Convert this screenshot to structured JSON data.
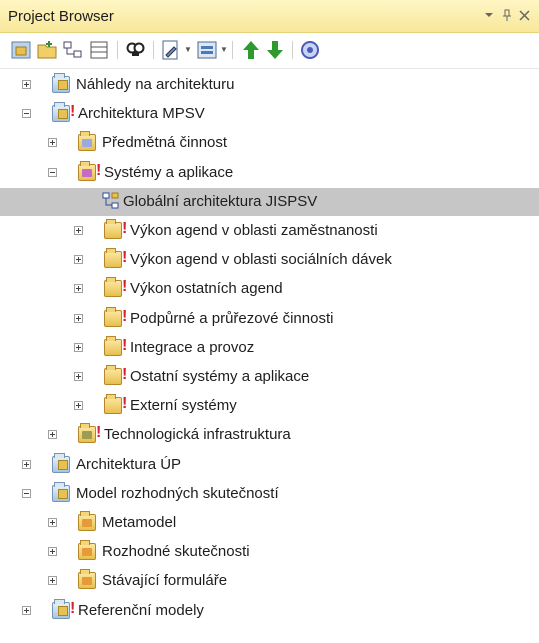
{
  "panel": {
    "title": "Project Browser",
    "controls": {
      "dropdown_icon": "chevron-down-icon",
      "pin_icon": "pin-icon",
      "close_icon": "close-icon"
    }
  },
  "toolbar": {
    "buttons": [
      "new-model-icon",
      "new-package-icon",
      "new-diagram-icon",
      "new-element-icon",
      "find-icon",
      "documentation-icon",
      "view-icon",
      "move-up-icon",
      "move-down-icon",
      "properties-icon"
    ]
  },
  "tree": [
    {
      "label": "Náhledy na architekturu",
      "icon": "model-package-icon",
      "expander": "collapsed",
      "flag": false,
      "selected": false
    },
    {
      "label": "Architektura MPSV",
      "icon": "model-package-icon",
      "expander": "expanded",
      "flag": true,
      "selected": false
    },
    {
      "label": "Předmětná činnost",
      "icon": "view-package-blue-icon",
      "expander": "collapsed",
      "flag": false,
      "selected": false
    },
    {
      "label": "Systémy a aplikace",
      "icon": "view-package-pink-icon",
      "expander": "expanded",
      "flag": true,
      "selected": false
    },
    {
      "label": "Globální architektura JISPSV",
      "icon": "diagram-icon",
      "expander": "none",
      "flag": false,
      "selected": true
    },
    {
      "label": "Výkon agend v oblasti zaměstnanosti",
      "icon": "package-icon",
      "expander": "collapsed",
      "flag": true,
      "selected": false
    },
    {
      "label": "Výkon agend v oblasti sociálních dávek",
      "icon": "package-icon",
      "expander": "collapsed",
      "flag": true,
      "selected": false
    },
    {
      "label": "Výkon ostatních agend",
      "icon": "package-icon",
      "expander": "collapsed",
      "flag": true,
      "selected": false
    },
    {
      "label": "Podpůrné a průřezové činnosti",
      "icon": "package-icon",
      "expander": "collapsed",
      "flag": true,
      "selected": false
    },
    {
      "label": "Integrace a provoz",
      "icon": "package-icon",
      "expander": "collapsed",
      "flag": true,
      "selected": false
    },
    {
      "label": "Ostatní systémy a aplikace",
      "icon": "package-icon",
      "expander": "collapsed",
      "flag": true,
      "selected": false
    },
    {
      "label": "Externí systémy",
      "icon": "package-icon",
      "expander": "collapsed",
      "flag": true,
      "selected": false
    },
    {
      "label": "Technologická infrastruktura",
      "icon": "view-package-olive-icon",
      "expander": "collapsed",
      "flag": true,
      "selected": false
    },
    {
      "label": "Architektura ÚP",
      "icon": "model-package-icon",
      "expander": "collapsed",
      "flag": false,
      "selected": false
    },
    {
      "label": "Model rozhodných skutečností",
      "icon": "model-package-icon",
      "expander": "expanded",
      "flag": false,
      "selected": false
    },
    {
      "label": "Metamodel",
      "icon": "view-package-orange-icon",
      "expander": "collapsed",
      "flag": false,
      "selected": false
    },
    {
      "label": "Rozhodné skutečnosti",
      "icon": "view-package-orange-icon",
      "expander": "collapsed",
      "flag": false,
      "selected": false
    },
    {
      "label": "Stávající formuláře",
      "icon": "view-package-orange-icon",
      "expander": "collapsed",
      "flag": false,
      "selected": false
    },
    {
      "label": "Referenční modely",
      "icon": "model-package-icon",
      "expander": "collapsed",
      "flag": true,
      "selected": false
    }
  ],
  "colors": {
    "title_bar": "#f8e89a",
    "selection": "#c6c6c6",
    "flag": "#d4202a",
    "move_arrows": "#2e9a2e"
  }
}
